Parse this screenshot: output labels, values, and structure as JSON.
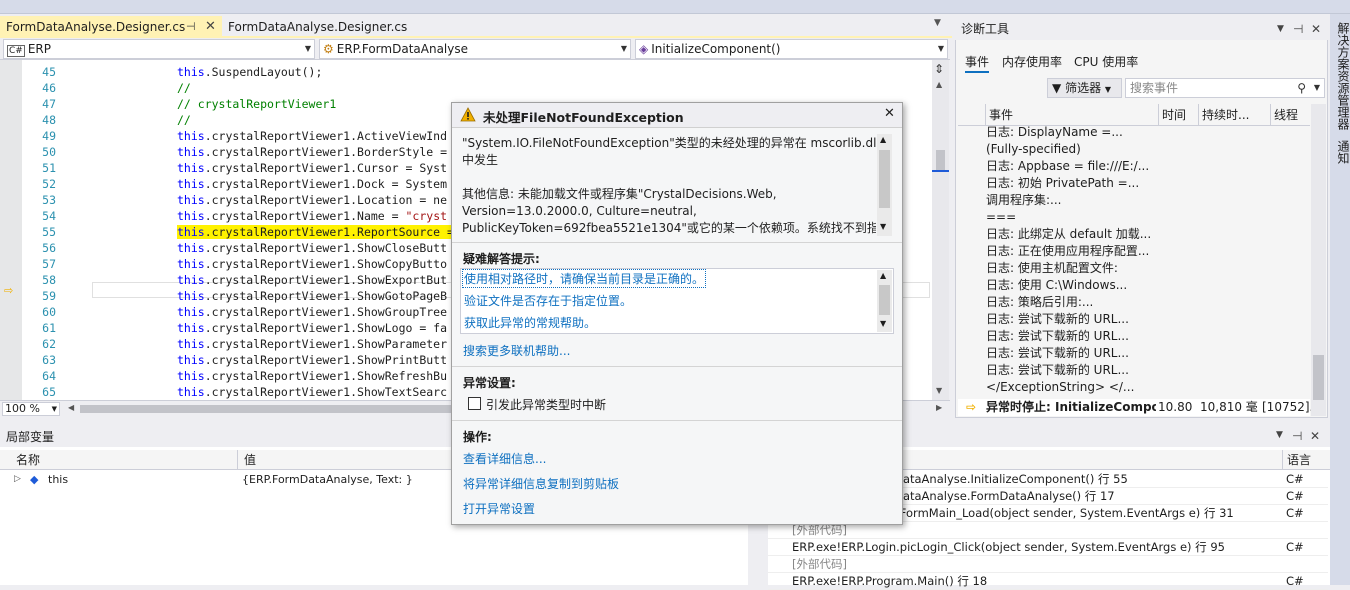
{
  "tabs": [
    {
      "label": "FormDataAnalyse.Designer.cs",
      "active": true
    },
    {
      "label": "FormDataAnalyse.Designer.cs",
      "active": false
    }
  ],
  "navbar": {
    "project": "ERP",
    "class": "ERP.FormDataAnalyse",
    "member": "InitializeComponent()"
  },
  "editor": {
    "lines": [
      {
        "num": "45",
        "code": "this.SuspendLayout();"
      },
      {
        "num": "46",
        "code": "//"
      },
      {
        "num": "47",
        "code": "// crystalReportViewer1"
      },
      {
        "num": "48",
        "code": "//"
      },
      {
        "num": "49",
        "code": "this.crystalReportViewer1.ActiveViewInd"
      },
      {
        "num": "50",
        "code": "this.crystalReportViewer1.BorderStyle ="
      },
      {
        "num": "51",
        "code": "this.crystalReportViewer1.Cursor = Syst"
      },
      {
        "num": "52",
        "code": "this.crystalReportViewer1.Dock = System"
      },
      {
        "num": "53",
        "code": "this.crystalReportViewer1.Location = ne"
      },
      {
        "num": "54",
        "code": "this.crystalReportViewer1.Name = \"cryst"
      },
      {
        "num": "55",
        "code": "this.crystalReportViewer1.ReportSource ="
      },
      {
        "num": "56",
        "code": "this.crystalReportViewer1.ShowCloseButt"
      },
      {
        "num": "57",
        "code": "this.crystalReportViewer1.ShowCopyButto"
      },
      {
        "num": "58",
        "code": "this.crystalReportViewer1.ShowExportBut"
      },
      {
        "num": "59",
        "code": "this.crystalReportViewer1.ShowGotoPageB"
      },
      {
        "num": "60",
        "code": "this.crystalReportViewer1.ShowGroupTree"
      },
      {
        "num": "61",
        "code": "this.crystalReportViewer1.ShowLogo = fa"
      },
      {
        "num": "62",
        "code": "this.crystalReportViewer1.ShowParameter"
      },
      {
        "num": "63",
        "code": "this.crystalReportViewer1.ShowPrintButt"
      },
      {
        "num": "64",
        "code": "this.crystalReportViewer1.ShowRefreshBu"
      },
      {
        "num": "65",
        "code": "this.crystalReportViewer1.ShowTextSearc"
      }
    ],
    "zoom": "100 %"
  },
  "diag": {
    "title": "诊断工具",
    "tabs": [
      "事件",
      "内存使用率",
      "CPU 使用率"
    ],
    "filter": "筛选器",
    "search_placeholder": "搜索事件",
    "columns": [
      "事件",
      "时间",
      "持续时...",
      "线程"
    ],
    "rows": [
      "日志: DisplayName =...",
      "(Fully-specified)",
      "日志: Appbase = file:///E:/...",
      "日志: 初始 PrivatePath =...",
      "调用程序集:...",
      "===",
      "日志: 此绑定从 default 加载...",
      "日志: 正在使用应用程序配置...",
      "日志: 使用主机配置文件:",
      "日志: 使用 C:\\Windows...",
      "日志: 策略后引用:...",
      "日志: 尝试下载新的 URL...",
      "日志: 尝试下载新的 URL...",
      "日志: 尝试下载新的 URL...",
      "日志: 尝试下载新的 URL...",
      "</ExceptionString> </..."
    ],
    "last": {
      "event": "异常时停止: InitializeCompo...",
      "time": "10.80",
      "duration": "10,810 毫",
      "thread": "[10752]..."
    }
  },
  "side": {
    "a": "解决方案资源管理器",
    "b": "通知"
  },
  "locals": {
    "title": "局部变量",
    "col_name": "名称",
    "col_value": "值",
    "row": {
      "name": "this",
      "value": "{ERP.FormDataAnalyse, Text: }"
    }
  },
  "callstack": {
    "col_lang": "语言",
    "rows": [
      {
        "text": "ERP.exe!ERP.FormDataAnalyse.InitializeComponent() 行 55",
        "lang": "C#",
        "ext": false
      },
      {
        "text": "ERP.exe!ERP.FormDataAnalyse.FormDataAnalyse() 行 17",
        "lang": "C#",
        "ext": false
      },
      {
        "text": "ERP.exe!ERP.Login.FormMain_Load(object sender, System.EventArgs e) 行 31",
        "lang": "C#",
        "ext": false
      },
      {
        "text": "[外部代码]",
        "lang": "",
        "ext": true
      },
      {
        "text": "ERP.exe!ERP.Login.picLogin_Click(object sender, System.EventArgs e) 行 95",
        "lang": "C#",
        "ext": false
      },
      {
        "text": "[外部代码]",
        "lang": "",
        "ext": true
      },
      {
        "text": "ERP.exe!ERP.Program.Main() 行 18",
        "lang": "C#",
        "ext": false
      }
    ]
  },
  "exception": {
    "title": "未处理FileNotFoundException",
    "msg1": "\"System.IO.FileNotFoundException\"类型的未经处理的异常在 mscorlib.dll",
    "msg2": "中发生",
    "msg3": "其他信息: 未能加载文件或程序集\"CrystalDecisions.Web,",
    "msg4": "Version=13.0.2000.0, Culture=neutral,",
    "msg5": "PublicKeyToken=692fbea5521e1304\"或它的某一个依赖项。系统找不到指",
    "tips_title": "疑难解答提示:",
    "tips": [
      "使用相对路径时，请确保当前目录是正确的。",
      "验证文件是否存在于指定位置。",
      "获取此异常的常规帮助。"
    ],
    "search_more": "搜索更多联机帮助...",
    "settings_title": "异常设置:",
    "break_label": "引发此异常类型时中断",
    "actions_title": "操作:",
    "actions": [
      "查看详细信息...",
      "将异常详细信息复制到剪贴板",
      "打开异常设置"
    ]
  }
}
